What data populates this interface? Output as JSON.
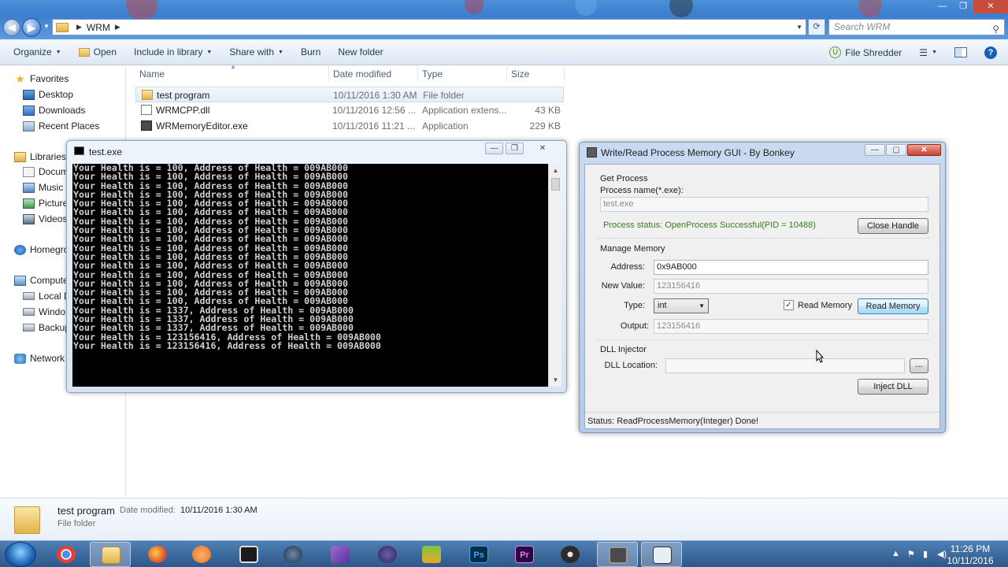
{
  "explorer": {
    "breadcrumb": [
      "WRM"
    ],
    "search_placeholder": "Search WRM",
    "toolbar": {
      "organize": "Organize",
      "open": "Open",
      "include_in_library": "Include in library",
      "share_with": "Share with",
      "burn": "Burn",
      "new_folder": "New folder",
      "file_shredder": "File Shredder"
    },
    "nav": {
      "favorites": "Favorites",
      "desktop": "Desktop",
      "downloads": "Downloads",
      "recent_places": "Recent Places",
      "libraries": "Libraries",
      "documents": "Docum",
      "music": "Music",
      "pictures": "Picture",
      "videos": "Videos",
      "homegroup": "Homegro",
      "computer": "Compute",
      "local_disk": "Local D",
      "windows": "Windo",
      "backup": "Backup",
      "network": "Network"
    },
    "columns": {
      "name": "Name",
      "date_modified": "Date modified",
      "type": "Type",
      "size": "Size"
    },
    "files": [
      {
        "name": "test program",
        "date": "10/11/2016 1:30 AM",
        "type": "File folder",
        "size": "",
        "icon": "folder-icon"
      },
      {
        "name": "WRMCPP.dll",
        "date": "10/11/2016 12:56 ...",
        "type": "Application extens...",
        "size": "43 KB",
        "icon": "dll-icon"
      },
      {
        "name": "WRMemoryEditor.exe",
        "date": "10/11/2016 11:21 ...",
        "type": "Application",
        "size": "229 KB",
        "icon": "exe-icon"
      }
    ],
    "details": {
      "name": "test program",
      "date_label": "Date modified:",
      "date_value": "10/11/2016 1:30 AM",
      "type": "File folder"
    }
  },
  "console": {
    "title": "test.exe",
    "lines": [
      "Your Health is = 100, Address of Health = 009AB000",
      "Your Health is = 100, Address of Health = 009AB000",
      "Your Health is = 100, Address of Health = 009AB000",
      "Your Health is = 100, Address of Health = 009AB000",
      "Your Health is = 100, Address of Health = 009AB000",
      "Your Health is = 100, Address of Health = 009AB000",
      "Your Health is = 100, Address of Health = 009AB000",
      "Your Health is = 100, Address of Health = 009AB000",
      "Your Health is = 100, Address of Health = 009AB000",
      "Your Health is = 100, Address of Health = 009AB000",
      "Your Health is = 100, Address of Health = 009AB000",
      "Your Health is = 100, Address of Health = 009AB000",
      "Your Health is = 100, Address of Health = 009AB000",
      "Your Health is = 100, Address of Health = 009AB000",
      "Your Health is = 100, Address of Health = 009AB000",
      "Your Health is = 100, Address of Health = 009AB000",
      "Your Health is = 1337, Address of Health = 009AB000",
      "Your Health is = 1337, Address of Health = 009AB000",
      "Your Health is = 1337, Address of Health = 009AB000",
      "Your Health is = 123156416, Address of Health = 009AB000",
      "Your Health is = 123156416, Address of Health = 009AB000"
    ]
  },
  "wrm": {
    "title": "Write/Read Process Memory GUI - By Bonkey",
    "get_process": {
      "group_label": "Get Process",
      "process_name_label": "Process name(*.exe):",
      "process_name_value": "test.exe",
      "status_text": "Process status: OpenProcess Successful(PID = 10488)",
      "close_handle": "Close Handle"
    },
    "manage_memory": {
      "group_label": "Manage Memory",
      "address_label": "Address:",
      "address_value": "0x9AB000",
      "new_value_label": "New Value:",
      "new_value_value": "123156416",
      "type_label": "Type:",
      "type_value": "int",
      "read_memory_check_label": "Read Memory",
      "read_memory_checked": "✓",
      "read_memory_button": "Read Memory",
      "output_label": "Output:",
      "output_value": "123156416"
    },
    "dll_injector": {
      "group_label": "DLL Injector",
      "location_label": "DLL Location:",
      "location_value": "",
      "browse_button": "...",
      "inject_button": "Inject DLL"
    },
    "status": "Status: ReadProcessMemory(Integer) Done!",
    "status_color": "#1e1e1e",
    "process_status_color": "#3a7d1e"
  },
  "taskbar": {
    "apps": [
      {
        "name": "chrome-icon",
        "label": ""
      },
      {
        "name": "explorer-icon",
        "label": ""
      },
      {
        "name": "firefox-icon",
        "label": ""
      },
      {
        "name": "media-player-icon",
        "label": ""
      },
      {
        "name": "video-editor-icon",
        "label": ""
      },
      {
        "name": "steam-icon",
        "label": ""
      },
      {
        "name": "visual-studio-icon",
        "label": ""
      },
      {
        "name": "eclipse-icon",
        "label": ""
      },
      {
        "name": "gallery-icon",
        "label": ""
      },
      {
        "name": "photoshop-icon",
        "label": "Ps"
      },
      {
        "name": "premiere-icon",
        "label": "Pr"
      },
      {
        "name": "obs-icon",
        "label": ""
      },
      {
        "name": "memory-editor-icon",
        "label": ""
      },
      {
        "name": "console-icon",
        "label": ""
      }
    ],
    "time": "11:26 PM",
    "date": "10/11/2016"
  }
}
